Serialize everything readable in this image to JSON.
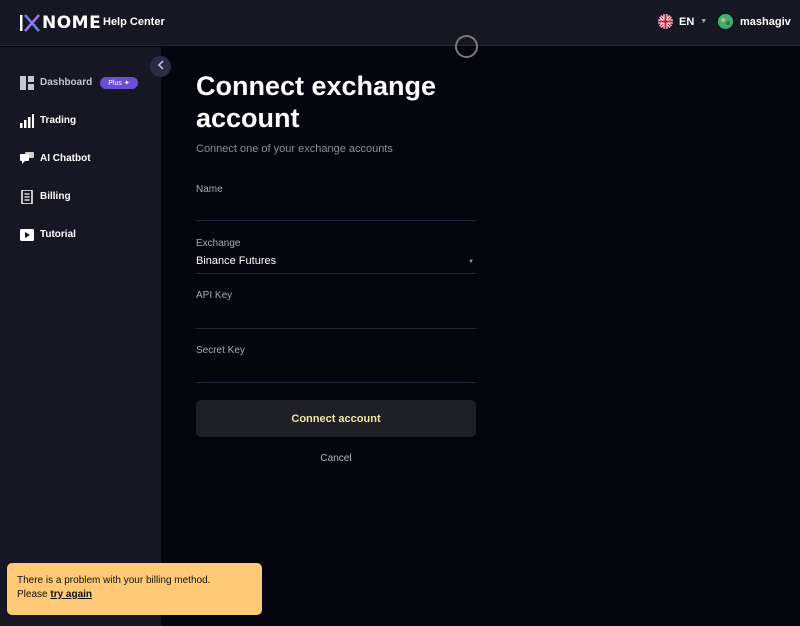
{
  "header": {
    "logo_text": "NOME",
    "help_center": "Help Center",
    "language": "EN",
    "username": "mashagiv"
  },
  "sidebar": {
    "items": [
      {
        "label": "Dashboard",
        "badge": "Plus"
      },
      {
        "label": "Trading"
      },
      {
        "label": "AI Chatbot"
      },
      {
        "label": "Billing"
      },
      {
        "label": "Tutorial"
      }
    ]
  },
  "form": {
    "title": "Connect exchange account",
    "subtitle": "Connect one of your exchange accounts",
    "name_label": "Name",
    "name_value": "",
    "exchange_label": "Exchange",
    "exchange_value": "Binance Futures",
    "api_key_label": "API Key",
    "api_key_value": "",
    "secret_key_label": "Secret Key",
    "secret_key_value": "",
    "connect_button": "Connect account",
    "cancel": "Cancel"
  },
  "toast": {
    "message": "There is a problem with your billing method.",
    "prefix": "Please",
    "link": "try again"
  },
  "colors": {
    "accent": "#6a4fd6",
    "toast_bg": "#ffc975",
    "button_text": "#f0e6a0"
  }
}
